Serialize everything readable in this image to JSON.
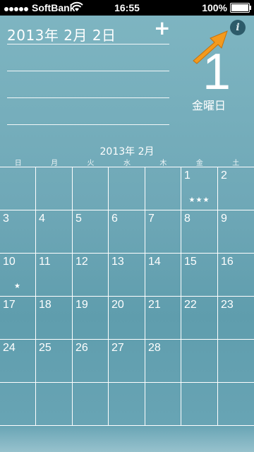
{
  "status_bar": {
    "carrier": "SoftBank",
    "time": "16:55",
    "battery": "100%"
  },
  "header": {
    "date": "2013年 2月 2日",
    "add_label": "+",
    "info_label": "i"
  },
  "day_panel": {
    "day_number": "1",
    "weekday": "金曜日"
  },
  "calendar": {
    "month_label": "2013年 2月",
    "weekdays": [
      "日",
      "月",
      "火",
      "水",
      "木",
      "金",
      "土"
    ],
    "weeks": [
      [
        {
          "n": ""
        },
        {
          "n": ""
        },
        {
          "n": ""
        },
        {
          "n": ""
        },
        {
          "n": ""
        },
        {
          "n": "1",
          "stars": "★★★"
        },
        {
          "n": "2"
        }
      ],
      [
        {
          "n": "3"
        },
        {
          "n": "4"
        },
        {
          "n": "5"
        },
        {
          "n": "6"
        },
        {
          "n": "7"
        },
        {
          "n": "8"
        },
        {
          "n": "9"
        }
      ],
      [
        {
          "n": "10",
          "stars": "★"
        },
        {
          "n": "11"
        },
        {
          "n": "12"
        },
        {
          "n": "13"
        },
        {
          "n": "14"
        },
        {
          "n": "15"
        },
        {
          "n": "16"
        }
      ],
      [
        {
          "n": "17"
        },
        {
          "n": "18"
        },
        {
          "n": "19"
        },
        {
          "n": "20"
        },
        {
          "n": "21"
        },
        {
          "n": "22"
        },
        {
          "n": "23"
        }
      ],
      [
        {
          "n": "24"
        },
        {
          "n": "25"
        },
        {
          "n": "26"
        },
        {
          "n": "27"
        },
        {
          "n": "28"
        },
        {
          "n": ""
        },
        {
          "n": ""
        }
      ],
      [
        {
          "n": ""
        },
        {
          "n": ""
        },
        {
          "n": ""
        },
        {
          "n": ""
        },
        {
          "n": ""
        },
        {
          "n": ""
        },
        {
          "n": ""
        }
      ]
    ]
  },
  "colors": {
    "arrow": "#f39a1e",
    "info_bg": "#2d5b6a"
  }
}
